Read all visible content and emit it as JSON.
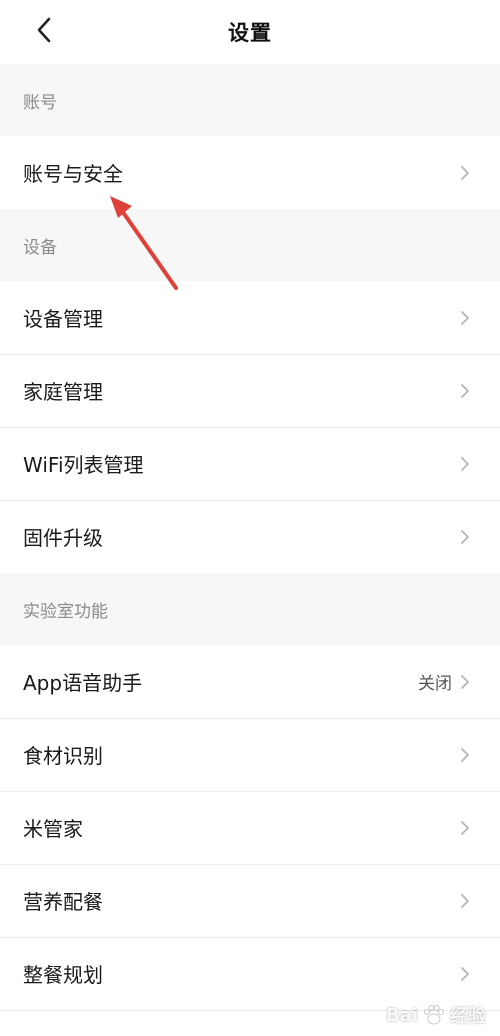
{
  "header": {
    "title": "设置"
  },
  "sections": [
    {
      "title": "账号",
      "items": [
        {
          "label": "账号与安全"
        }
      ]
    },
    {
      "title": "设备",
      "items": [
        {
          "label": "设备管理"
        },
        {
          "label": "家庭管理"
        },
        {
          "label": "WiFi列表管理"
        },
        {
          "label": "固件升级"
        }
      ]
    },
    {
      "title": "实验室功能",
      "items": [
        {
          "label": "App语音助手",
          "value": "关闭"
        },
        {
          "label": "食材识别"
        },
        {
          "label": "米管家"
        },
        {
          "label": "营养配餐"
        },
        {
          "label": "整餐规划"
        }
      ]
    }
  ],
  "watermark": {
    "text_left": "Bai",
    "text_right": "经验"
  },
  "colors": {
    "annotation_arrow": "#e0403a",
    "background": "#f7f7f7",
    "row_background": "#ffffff"
  },
  "icons": {
    "back": "chevron-left-icon",
    "row_arrow": "chevron-right-icon"
  }
}
